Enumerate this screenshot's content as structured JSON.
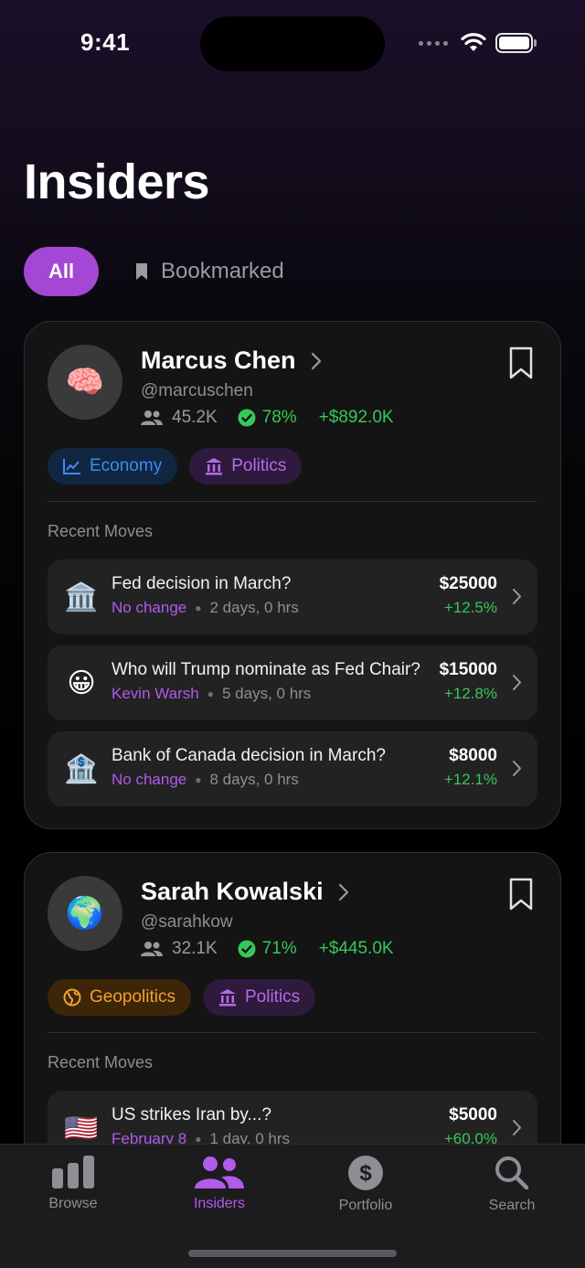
{
  "status_bar": {
    "time": "9:41"
  },
  "page": {
    "title": "Insiders"
  },
  "filters": {
    "all": "All",
    "bookmarked": "Bookmarked"
  },
  "colors": {
    "accent": "#a347d4",
    "positive": "#35c759",
    "economy": "#3c8cf0",
    "politics": "#b66ae8",
    "geopolitics": "#f0a230"
  },
  "insiders": [
    {
      "avatar_icon": "brain-emoji",
      "avatar_glyph": "🧠",
      "name": "Marcus Chen",
      "handle": "@marcuschen",
      "followers": "45.2K",
      "win_rate": "78%",
      "profit": "+$892.0K",
      "tags": [
        "Economy",
        "Politics"
      ],
      "section_label": "Recent Moves",
      "moves": [
        {
          "icon": "classical-building-emoji",
          "glyph": "🏛️",
          "title": "Fed decision in March?",
          "outcome": "No change",
          "time": "2 days, 0 hrs",
          "amount": "$25000",
          "change": "+12.5%"
        },
        {
          "icon": "grinning-face-emoji",
          "glyph": "😀",
          "title": "Who will Trump nominate as Fed Chair?",
          "outcome": "Kevin Warsh",
          "time": "5 days, 0 hrs",
          "amount": "$15000",
          "change": "+12.8%"
        },
        {
          "icon": "bank-emoji",
          "glyph": "🏦",
          "title": "Bank of Canada decision in March?",
          "outcome": "No change",
          "time": "8 days, 0 hrs",
          "amount": "$8000",
          "change": "+12.1%"
        }
      ]
    },
    {
      "avatar_icon": "globe-emoji",
      "avatar_glyph": "🌍",
      "name": "Sarah Kowalski",
      "handle": "@sarahkow",
      "followers": "32.1K",
      "win_rate": "71%",
      "profit": "+$445.0K",
      "tags": [
        "Geopolitics",
        "Politics"
      ],
      "section_label": "Recent Moves",
      "moves": [
        {
          "icon": "us-flag-emoji",
          "glyph": "🇺🇸",
          "title": "US strikes Iran by...?",
          "outcome": "February 8",
          "time": "1 day, 0 hrs",
          "amount": "$5000",
          "change": "+60.0%"
        }
      ]
    }
  ],
  "tab_bar": {
    "items": [
      {
        "label": "Browse",
        "icon": "bar-chart-icon"
      },
      {
        "label": "Insiders",
        "icon": "people-icon"
      },
      {
        "label": "Portfolio",
        "icon": "dollar-circle-icon"
      },
      {
        "label": "Search",
        "icon": "magnifier-icon"
      }
    ],
    "active": "Insiders"
  }
}
